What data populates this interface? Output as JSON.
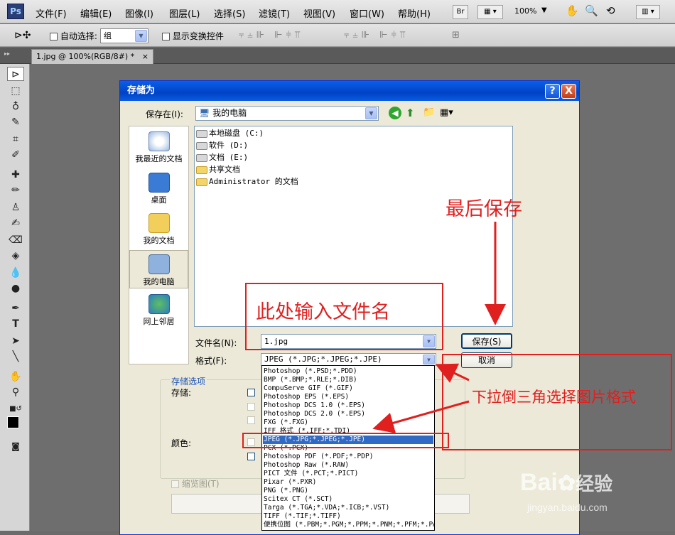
{
  "app": {
    "logo": "Ps"
  },
  "menubar": {
    "items": [
      "文件(F)",
      "编辑(E)",
      "图像(I)",
      "图层(L)",
      "选择(S)",
      "滤镜(T)",
      "视图(V)",
      "窗口(W)",
      "帮助(H)"
    ],
    "bridge_label": "Br",
    "zoom": "100%"
  },
  "optionsbar": {
    "auto_select_label": "自动选择:",
    "auto_select_value": "组",
    "show_transform_label": "显示变换控件"
  },
  "document": {
    "tab_label": "1.jpg @ 100%(RGB/8#) *",
    "close_glyph": "×"
  },
  "dialog": {
    "title": "存储为",
    "help_glyph": "?",
    "close_glyph": "X",
    "save_in_label": "保存在(I):",
    "save_in_value": "我的电脑",
    "places": [
      "我最近的文档",
      "桌面",
      "我的文档",
      "我的电脑",
      "网上邻居"
    ],
    "files": [
      "本地磁盘 (C:)",
      "软件 (D:)",
      "文档 (E:)",
      "共享文档",
      "Administrator 的文档"
    ],
    "filename_label": "文件名(N):",
    "filename_value": "1.jpg",
    "format_label": "格式(F):",
    "format_value": "JPEG (*.JPG;*.JPEG;*.JPE)",
    "save_button": "保存(S)",
    "cancel_button": "取消",
    "save_options_title": "存储选项",
    "save_label": "存储:",
    "color_label": "颜色:",
    "thumbnail_label": "缩览图(T)"
  },
  "format_options": [
    "Photoshop (*.PSD;*.PDD)",
    "BMP (*.BMP;*.RLE;*.DIB)",
    "CompuServe GIF (*.GIF)",
    "Photoshop EPS (*.EPS)",
    "Photoshop DCS 1.0 (*.EPS)",
    "Photoshop DCS 2.0 (*.EPS)",
    "FXG (*.FXG)",
    "IFF 格式 (*.IFF;*.TDI)",
    "JPEG (*.JPG;*.JPEG;*.JPE)",
    "PCX (*.PCX)",
    "Photoshop PDF (*.PDF;*.PDP)",
    "Photoshop Raw (*.RAW)",
    "PICT 文件 (*.PCT;*.PICT)",
    "Pixar (*.PXR)",
    "PNG (*.PNG)",
    "Scitex CT (*.SCT)",
    "Targa (*.TGA;*.VDA;*.ICB;*.VST)",
    "TIFF (*.TIF;*.TIFF)",
    "便携位图 (*.PBM;*.PGM;*.PPM;*.PNM;*.PFM;*.PAM)"
  ],
  "selected_format_index": 8,
  "annotations": {
    "final_save": "最后保存",
    "enter_filename": "此处输入文件名",
    "choose_format": "下拉倒三角选择图片格式"
  },
  "watermark": {
    "brand": "Bai",
    "brand2": "经验",
    "url": "jingyan.baidu.com"
  },
  "colors": {
    "annotation_red": "#e0201f",
    "xp_title_blue": "#0042c5",
    "selection_blue": "#316ac5"
  }
}
